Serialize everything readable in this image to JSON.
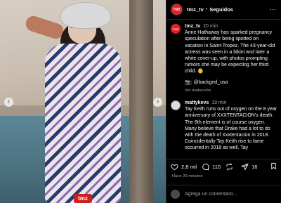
{
  "photo": {
    "watermark": "tmz",
    "prev_arrow": "‹",
    "next_arrow": "›",
    "alt": "Woman in sun hat and patterned swimsuit on a beach"
  },
  "header": {
    "avatar_text": "TMZ",
    "username": "tmz_tv",
    "dot": "•",
    "follow_label": "Seguidos",
    "more_icon": "⋯"
  },
  "comments": [
    {
      "avatar": "TMZ",
      "user": "tmz_tv",
      "time": "20 min",
      "text": "Anne Hathaway has sparked pregnancy speculation after being spotted on vacation in Saint-Tropez. The 43-year-old actress was seen in a bikini and later a white cover-up, with photos prompting rumors she may be expecting her third child. 👶",
      "credit": "📷: @backgrid_usa",
      "translate": "Ver traducción"
    },
    {
      "user": "mattykevs",
      "time": "19 min",
      "text": "Tay Keith runs out of oxygen on the 8 year anniversary of XXXTENTACION's death. The 8th element is of course oxygen. Many believe that Drake had a lot to do with the death of Xxxtentacion in 2018. Coincidentally Tay Keith rise to fame occurred in 2018 as well. Tay"
    }
  ],
  "actions": {
    "likes": "2,8 mil",
    "comments": "110",
    "shares": "16"
  },
  "time_ago": "Hace 20 minutos",
  "add_comment": {
    "placeholder": "Agrega un comentario..."
  },
  "icons": [
    "prev-arrow-icon",
    "next-arrow-icon",
    "more-icon",
    "heart-icon",
    "comment-icon",
    "repost-icon",
    "share-icon",
    "bookmark-icon"
  ]
}
